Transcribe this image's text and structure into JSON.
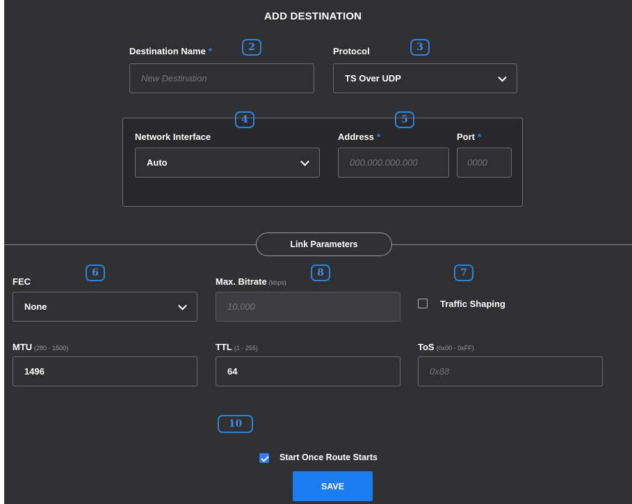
{
  "title": "ADD DESTINATION",
  "destination_name": {
    "label": "Destination Name",
    "required_mark": "*",
    "placeholder": "New Destination",
    "badge": "2"
  },
  "protocol": {
    "label": "Protocol",
    "value": "TS Over UDP",
    "badge": "3"
  },
  "network_interface": {
    "label": "Network Interface",
    "value": "Auto",
    "badge": "4"
  },
  "address": {
    "label": "Address",
    "required_mark": "*",
    "placeholder": "000.000.000.000",
    "badge": "5"
  },
  "port": {
    "label": "Port",
    "required_mark": "*",
    "placeholder": "0000"
  },
  "link_parameters": {
    "label": "Link Parameters"
  },
  "fec": {
    "label": "FEC",
    "value": "None",
    "badge": "6"
  },
  "max_bitrate": {
    "label": "Max. Bitrate",
    "hint": "(kbps)",
    "placeholder": "10,000",
    "badge": "8"
  },
  "traffic_shaping": {
    "label": "Traffic Shaping",
    "checked": false,
    "badge": "7"
  },
  "mtu": {
    "label": "MTU",
    "hint": "(280 - 1500)",
    "value": "1496"
  },
  "ttl": {
    "label": "TTL",
    "hint": "(1 - 255)",
    "value": "64"
  },
  "tos": {
    "label": "ToS",
    "hint": "(0x00 - 0xFF)",
    "placeholder": "0x88"
  },
  "start_once": {
    "label": "Start Once Route Starts",
    "checked": true,
    "badge": "10"
  },
  "save_button": {
    "label": "SAVE"
  },
  "colors": {
    "background": "#303033",
    "accent": "#1a7cf0",
    "badge": "#2a84e0",
    "required": "#2d7ef7"
  }
}
